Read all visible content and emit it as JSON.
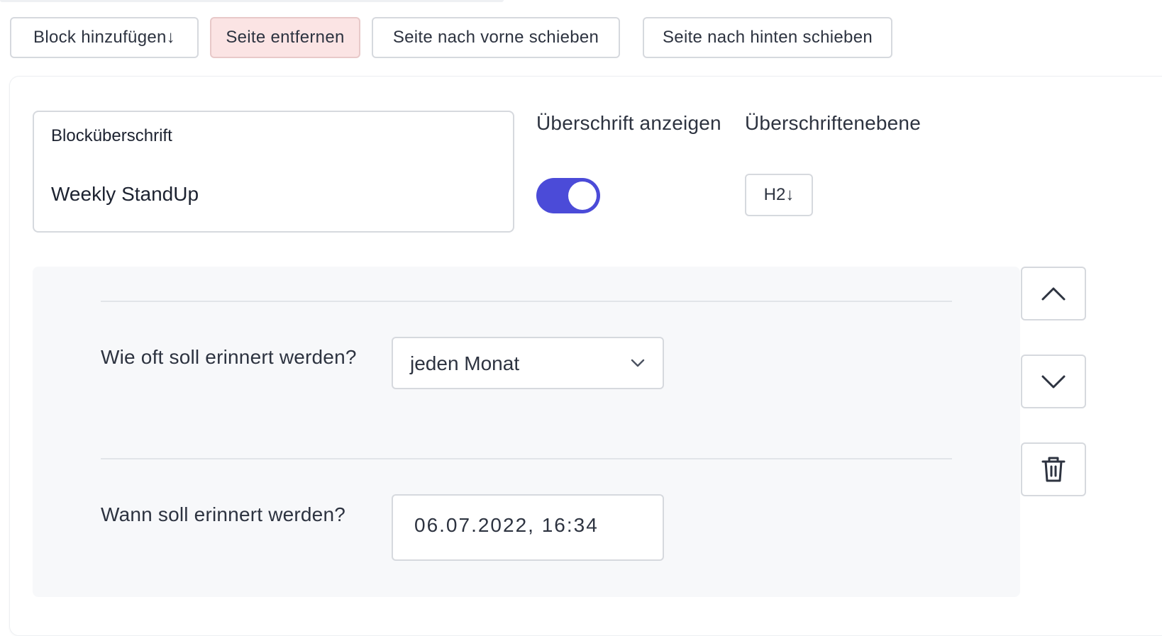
{
  "toolbar": {
    "add_block": "Block hinzufügen↓",
    "remove_page": "Seite entfernen",
    "move_forward": "Seite nach vorne schieben",
    "move_backward": "Seite nach hinten schieben"
  },
  "block": {
    "title_label": "Blocküberschrift",
    "title_value": "Weekly StandUp",
    "show_heading_label": "Überschrift anzeigen",
    "show_heading_on": true,
    "heading_level_label": "Überschriftenebene",
    "heading_level_value": "H2↓"
  },
  "reminder": {
    "frequency_label": "Wie oft soll erinnert werden?",
    "frequency_value": "jeden Monat",
    "datetime_label": "Wann soll erinnert werden?",
    "datetime_value": "06.07.2022, 16:34"
  },
  "icons": {
    "up": "chevron-up-icon",
    "down": "chevron-down-icon",
    "delete": "trash-icon",
    "select": "chevron-down-icon"
  },
  "colors": {
    "toggle_on": "#4b4bd8",
    "danger_bg": "#fbe4e4",
    "panel_bg": "#f7f8fa"
  }
}
